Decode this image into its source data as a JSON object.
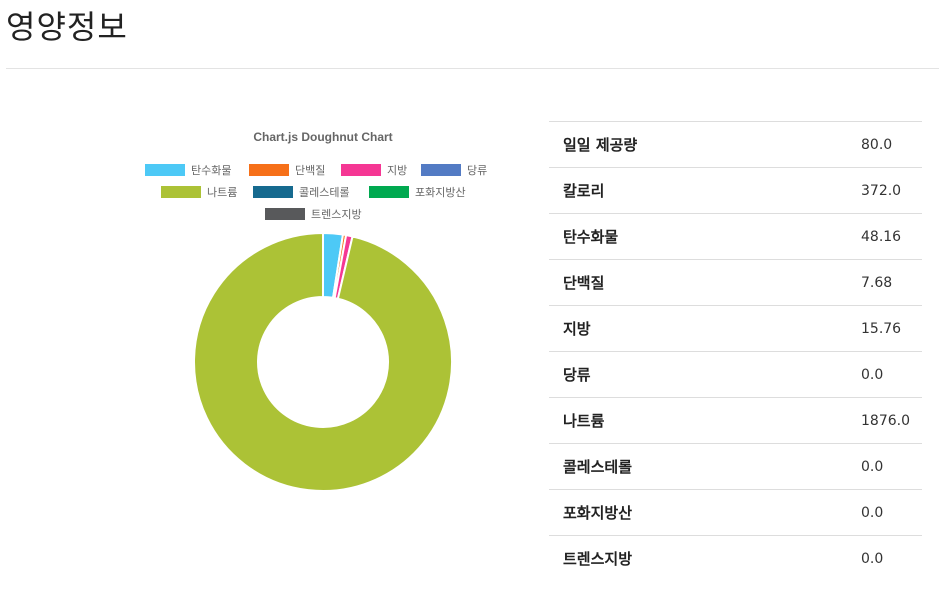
{
  "page": {
    "title": "영양정보"
  },
  "chart_data": {
    "type": "doughnut",
    "title": "Chart.js Doughnut Chart",
    "legend_position": "top",
    "categories": [
      "탄수화물",
      "단백질",
      "지방",
      "당류",
      "나트륨",
      "콜레스테롤",
      "포화지방산",
      "트렌스지방"
    ],
    "values": [
      48.16,
      7.68,
      15.76,
      0.0,
      1876.0,
      0.0,
      0.0,
      0.0
    ],
    "colors": [
      "#4dc9f6",
      "#f67019",
      "#f53794",
      "#537bc4",
      "#acc236",
      "#166a8f",
      "#00a950",
      "#58595b"
    ]
  },
  "table": {
    "rows": [
      {
        "label": "일일 제공량",
        "value": "80.0"
      },
      {
        "label": "칼로리",
        "value": "372.0"
      },
      {
        "label": "탄수화물",
        "value": "48.16"
      },
      {
        "label": "단백질",
        "value": "7.68"
      },
      {
        "label": "지방",
        "value": "15.76"
      },
      {
        "label": "당류",
        "value": "0.0"
      },
      {
        "label": "나트륨",
        "value": "1876.0"
      },
      {
        "label": "콜레스테롤",
        "value": "0.0"
      },
      {
        "label": "포화지방산",
        "value": "0.0"
      },
      {
        "label": "트렌스지방",
        "value": "0.0"
      }
    ]
  }
}
